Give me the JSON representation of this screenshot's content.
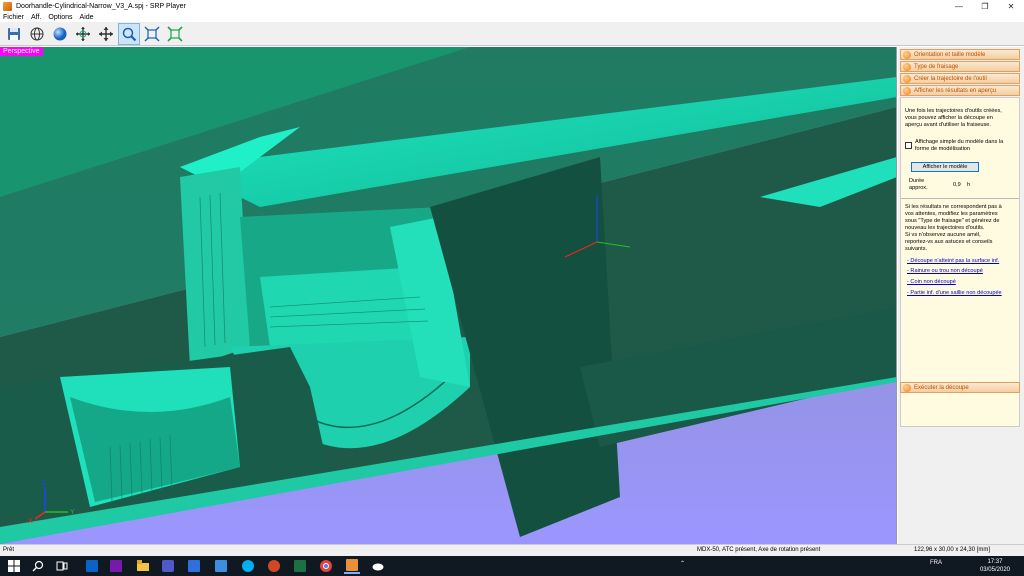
{
  "window": {
    "title": "Doorhandle-Cylindrical-Narrow_V3_A.spj - SRP Player",
    "controls": {
      "minimize": "—",
      "restore": "❐",
      "close": "✕"
    }
  },
  "menu": [
    "Fichier",
    "Aff.",
    "Options",
    "Aide"
  ],
  "toolbar": {
    "buttons": [
      {
        "name": "save",
        "icon": "save-icon"
      },
      {
        "name": "globe",
        "icon": "globe-icon"
      },
      {
        "name": "sphere",
        "icon": "sphere-icon"
      },
      {
        "name": "rotate",
        "icon": "rotate-icon"
      },
      {
        "name": "pan",
        "icon": "pan-icon"
      },
      {
        "name": "zoom",
        "icon": "zoom-icon",
        "active": true
      },
      {
        "name": "fit",
        "icon": "fit-icon"
      },
      {
        "name": "extents",
        "icon": "extents-icon"
      }
    ]
  },
  "viewport": {
    "label": "Perspective",
    "colors": {
      "background_top": "#8a8fb0",
      "background_bottom": "#9b96ff",
      "model_dark": "#1f5a48",
      "model_cyan": "#19e3be",
      "model_teal": "#12a888"
    },
    "axis_labels": {
      "x": "X",
      "y": "Y",
      "z": "Z"
    }
  },
  "sidepanel": {
    "steps": [
      "Orientation et taille modèle",
      "Type de fraisage",
      "Créer la trajectoire de l'outil",
      "Afficher les résultats en aperçu"
    ],
    "intro_lines": [
      "Une fois les trajectoires d'outils créées,",
      "vous pouvez afficher la découpe en",
      "aperçu avant d'utiliser la fraiseuse."
    ],
    "checkbox_lines": [
      "Affichage simple du modèle dans la",
      "forme de modélisation"
    ],
    "show_button": "Afficher le modèle",
    "duration_label_lines": [
      "Durée",
      "approx."
    ],
    "duration_value": "0,9",
    "duration_unit": "h",
    "advice_lines": [
      "Si les résultats ne correspondent pas à",
      "vos attentes, modifiez les paramètres",
      "sous \"Type de fraisage\" et générez de",
      "nouveau les trajectoires d'outils.",
      "Si vs n'observez aucune amél,",
      "reportez-vs aux astuces et conseils",
      "suivants."
    ],
    "links": [
      "- Découpe n'atteint pas la surface inf.",
      "- Rainure ou trou non découpé",
      "- Coin non découpé",
      "- Partie inf. d'une saillie non découpée"
    ],
    "execute": "Exécuter la découpe",
    "accent": "#f08020"
  },
  "status": {
    "left": "Prêt",
    "middle": "MDX-50, ATC présent, Axe de rotation présent",
    "right": "122,96 x 30,00 x 24,30 [mm]"
  },
  "taskbar": {
    "language": "FRA",
    "time": "17:37",
    "date": "03/05/2020"
  }
}
